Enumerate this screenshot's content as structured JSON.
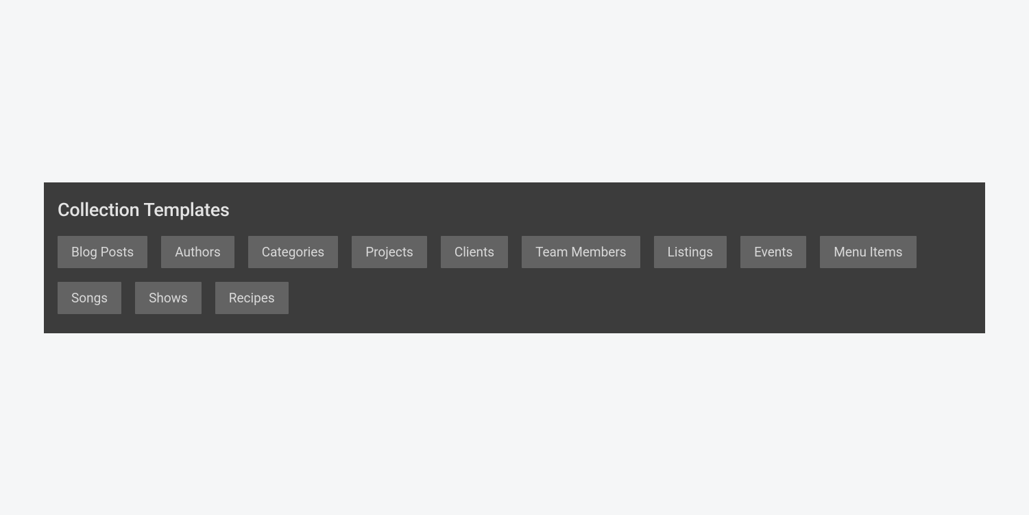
{
  "panel": {
    "title": "Collection Templates",
    "templates": [
      "Blog Posts",
      "Authors",
      "Categories",
      "Projects",
      "Clients",
      "Team Members",
      "Listings",
      "Events",
      "Menu Items",
      "Songs",
      "Shows",
      "Recipes"
    ]
  }
}
